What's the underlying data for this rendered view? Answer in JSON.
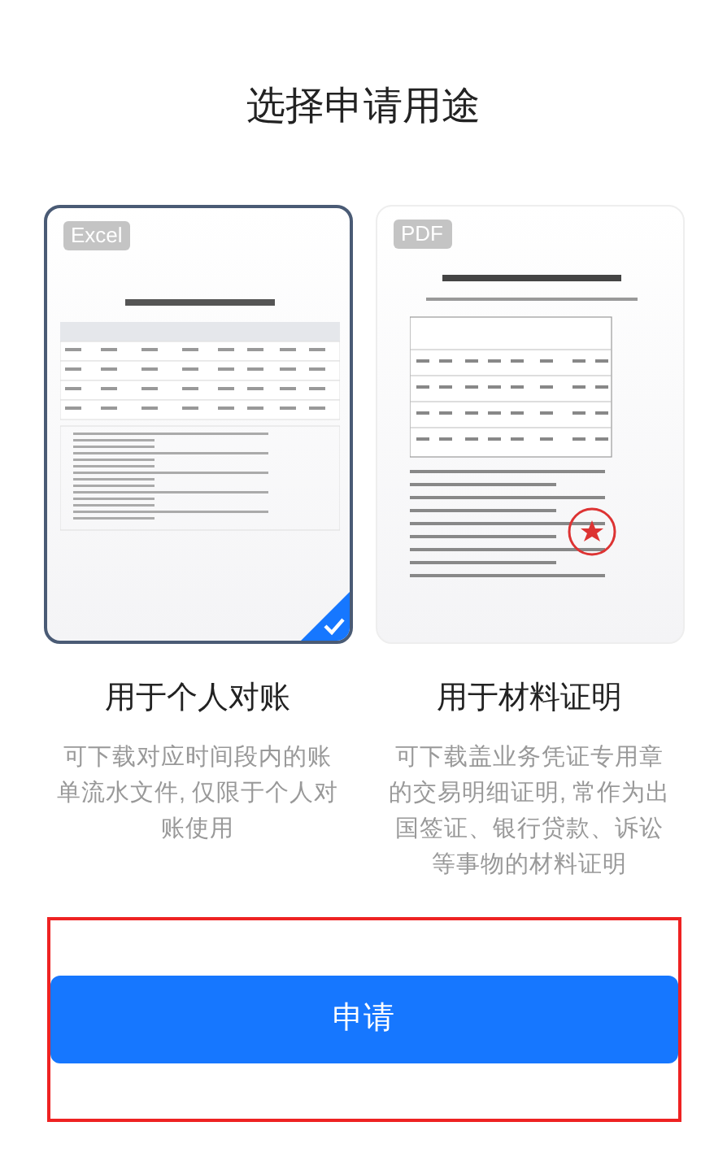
{
  "title": "选择申请用途",
  "options": [
    {
      "badge": "Excel",
      "kind": "statement",
      "label": "用于个人对账",
      "description": "可下载对应时间段内的账单流水文件, 仅限于个人对账使用",
      "selected": true
    },
    {
      "badge": "PDF",
      "kind": "certificate",
      "label": "用于材料证明",
      "description": "可下载盖业务凭证专用章的交易明细证明, 常作为出国签证、银行贷款、诉讼等事物的材料证明",
      "selected": false
    }
  ],
  "button": "申请"
}
